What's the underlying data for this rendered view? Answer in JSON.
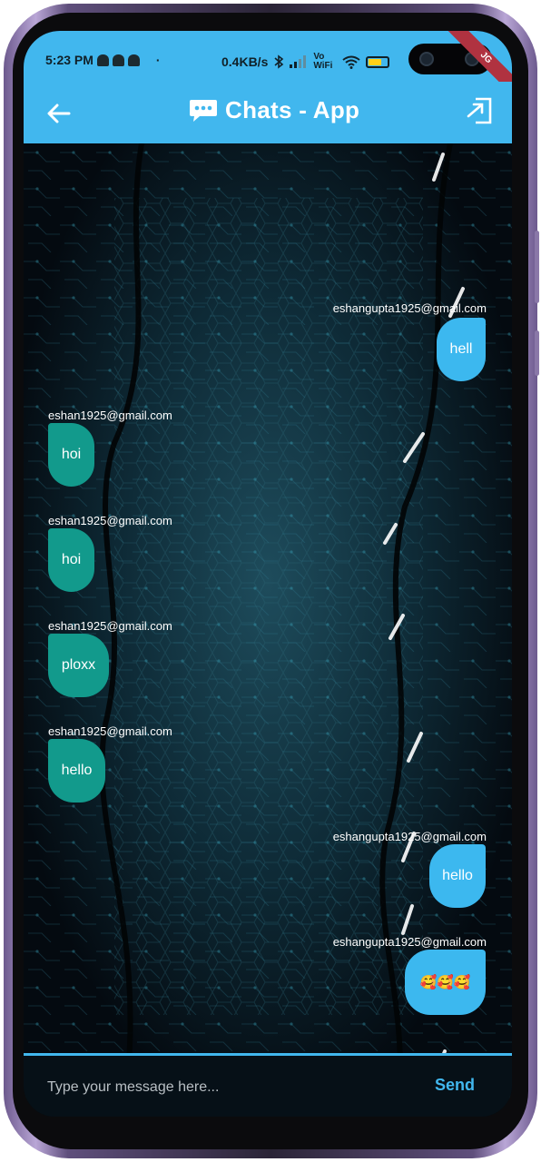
{
  "status_bar": {
    "time": "5:23 PM",
    "notification_icons": [
      "snapchat-icon",
      "snapchat-icon",
      "snapchat-icon"
    ],
    "dot": "·",
    "net_speed": "0.4KB/s",
    "vowifi": "Vo WiFi",
    "ribbon_text": "JG"
  },
  "app_bar": {
    "title": "Chats - App",
    "back_icon": "arrow-left-icon",
    "chat_icon": "chat-bubble-icon",
    "exit_icon": "exit-icon",
    "color": "#41b7ee"
  },
  "messages": [
    {
      "sender": "eshangupta1925@gmail.com",
      "text": "hell",
      "side": "right"
    },
    {
      "sender": "eshan1925@gmail.com",
      "text": "hoi",
      "side": "left"
    },
    {
      "sender": "eshan1925@gmail.com",
      "text": "hoi",
      "side": "left"
    },
    {
      "sender": "eshan1925@gmail.com",
      "text": "ploxx",
      "side": "left"
    },
    {
      "sender": "eshan1925@gmail.com",
      "text": "hello",
      "side": "left"
    },
    {
      "sender": "eshangupta1925@gmail.com",
      "text": "hello",
      "side": "right"
    },
    {
      "sender": "eshangupta1925@gmail.com",
      "text": "🥰🥰🥰",
      "side": "right"
    }
  ],
  "composer": {
    "placeholder": "Type your message here...",
    "value": "",
    "send_label": "Send"
  },
  "colors": {
    "left_bubble": "#129a8c",
    "right_bubble": "#3cb8ef",
    "accent": "#41b7ee"
  }
}
